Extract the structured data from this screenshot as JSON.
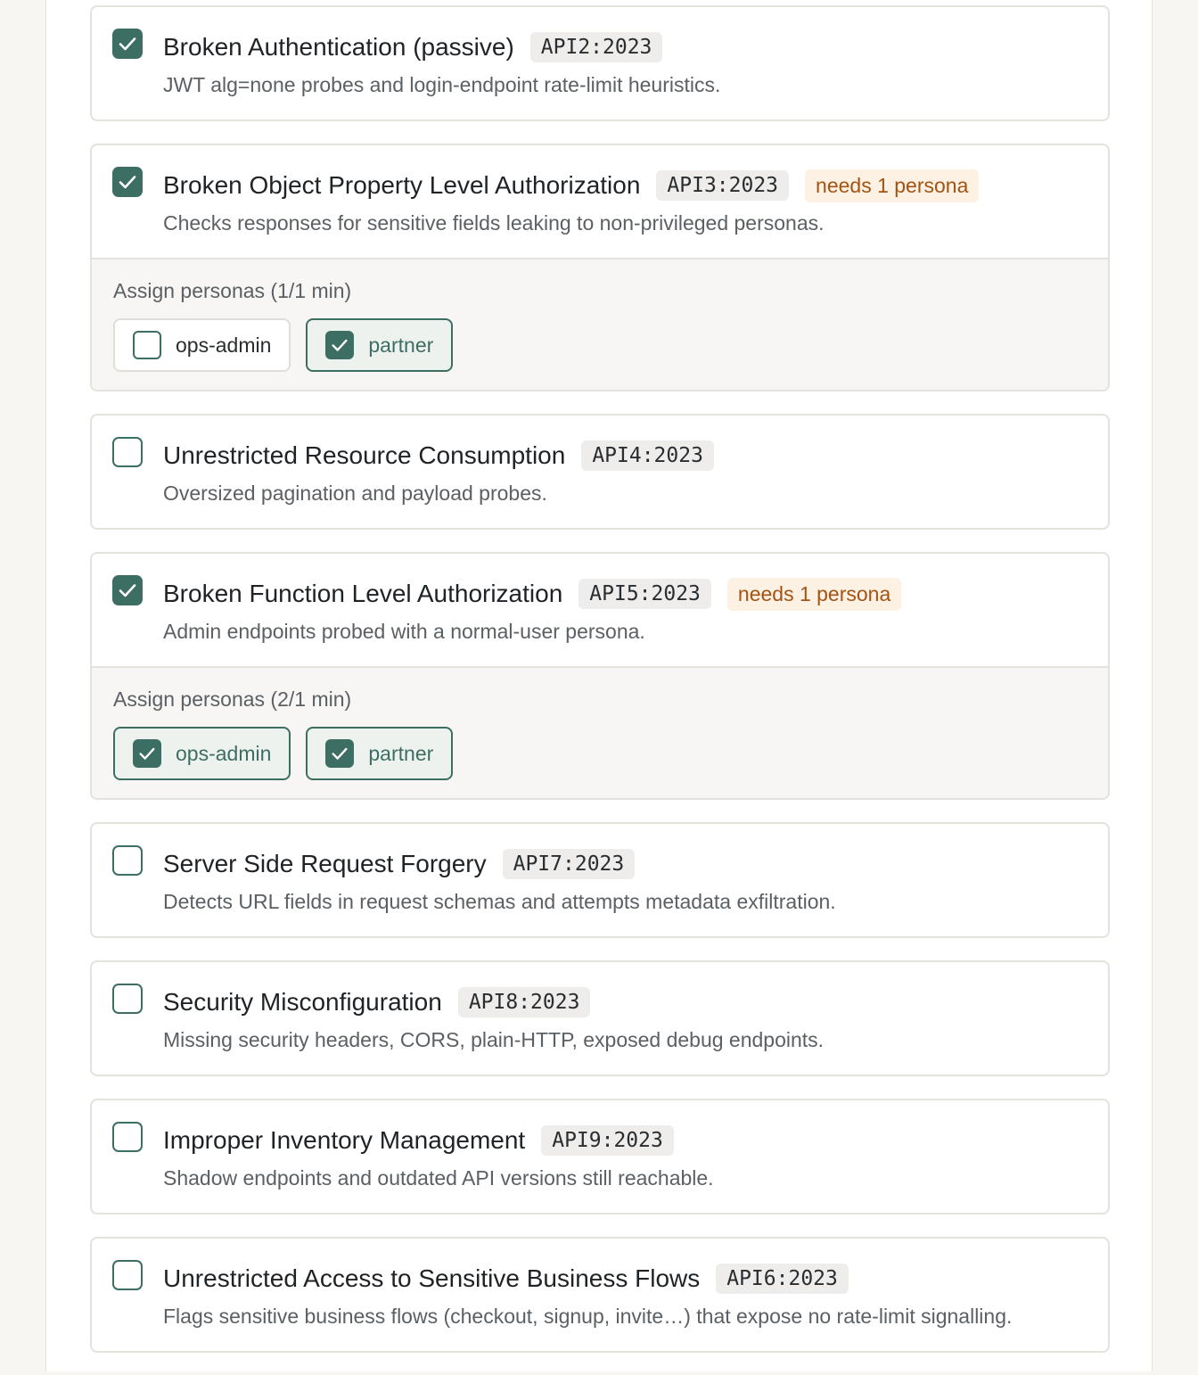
{
  "colors": {
    "accent": "#3d6e63",
    "warning_text": "#a35415",
    "warning_bg": "#fcf1e2"
  },
  "checks": [
    {
      "title": "Broken Authentication (passive)",
      "code": "API2:2023",
      "badge": "",
      "description": "JWT alg=none probes and login-endpoint rate-limit heuristics.",
      "checked": true,
      "personas": null
    },
    {
      "title": "Broken Object Property Level Authorization",
      "code": "API3:2023",
      "badge": "needs 1 persona",
      "description": "Checks responses for sensitive fields leaking to non-privileged personas.",
      "checked": true,
      "personas": {
        "label": "Assign personas (1/1 min)",
        "options": [
          {
            "name": "ops-admin",
            "selected": false
          },
          {
            "name": "partner",
            "selected": true
          }
        ]
      }
    },
    {
      "title": "Unrestricted Resource Consumption",
      "code": "API4:2023",
      "badge": "",
      "description": "Oversized pagination and payload probes.",
      "checked": false,
      "personas": null
    },
    {
      "title": "Broken Function Level Authorization",
      "code": "API5:2023",
      "badge": "needs 1 persona",
      "description": "Admin endpoints probed with a normal-user persona.",
      "checked": true,
      "personas": {
        "label": "Assign personas (2/1 min)",
        "options": [
          {
            "name": "ops-admin",
            "selected": true
          },
          {
            "name": "partner",
            "selected": true
          }
        ]
      }
    },
    {
      "title": "Server Side Request Forgery",
      "code": "API7:2023",
      "badge": "",
      "description": "Detects URL fields in request schemas and attempts metadata exfiltration.",
      "checked": false,
      "personas": null
    },
    {
      "title": "Security Misconfiguration",
      "code": "API8:2023",
      "badge": "",
      "description": "Missing security headers, CORS, plain-HTTP, exposed debug endpoints.",
      "checked": false,
      "personas": null
    },
    {
      "title": "Improper Inventory Management",
      "code": "API9:2023",
      "badge": "",
      "description": "Shadow endpoints and outdated API versions still reachable.",
      "checked": false,
      "personas": null
    },
    {
      "title": "Unrestricted Access to Sensitive Business Flows",
      "code": "API6:2023",
      "badge": "",
      "description": "Flags sensitive business flows (checkout, signup, invite…) that expose no rate-limit signalling.",
      "checked": false,
      "personas": null
    }
  ]
}
